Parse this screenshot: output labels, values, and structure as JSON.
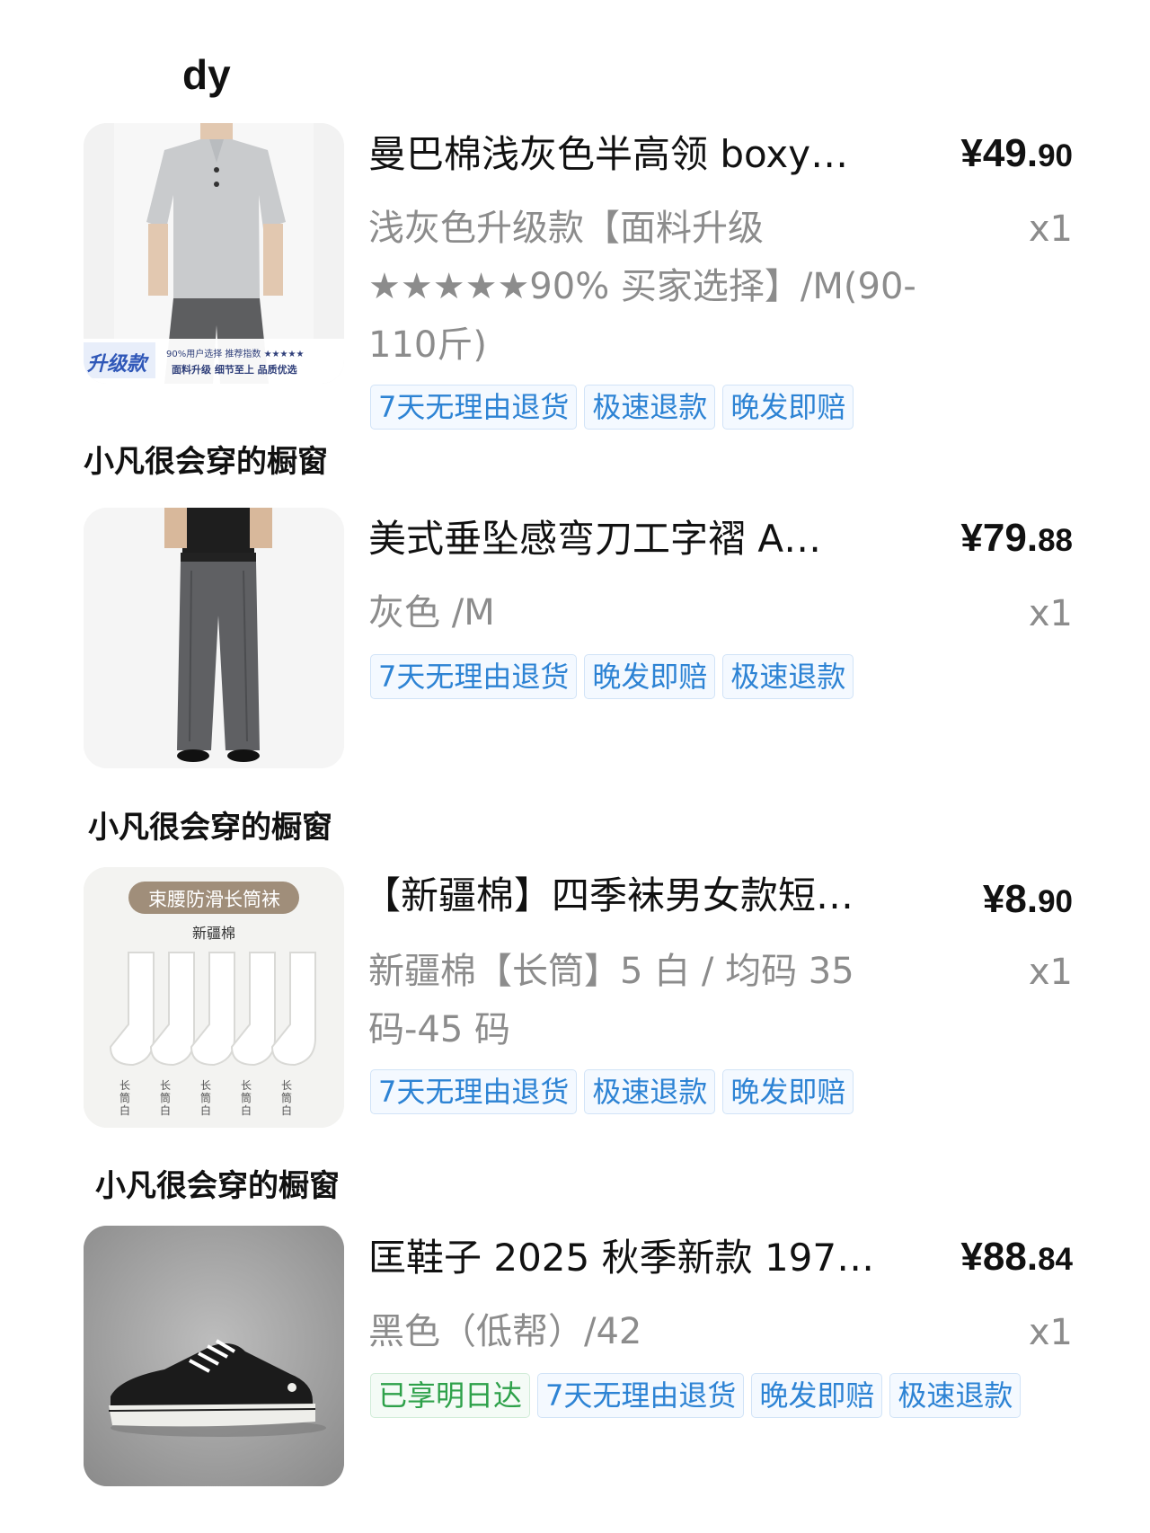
{
  "top_label": "dy",
  "shop_label": "小凡很会穿的橱窗",
  "items": [
    {
      "title": "曼巴棉浅灰色半高领 boxy…",
      "price_big": "¥49.",
      "price_small": "90",
      "variant": "浅灰色升级款【面料升级★★★★★90% 买家选择】/M(90-110斤)",
      "qty": "x1",
      "image_badge": "升级款",
      "image_caption_1": "90%用户选择  推荐指数 ★★★★★",
      "image_caption_2": "面料升级 细节至上 品质优选",
      "tags": [
        "7天无理由退货",
        "极速退款",
        "晚发即赔"
      ]
    },
    {
      "title": "美式垂坠感弯刀工字褶 A…",
      "price_big": "¥79.",
      "price_small": "88",
      "variant": "灰色 /M",
      "qty": "x1",
      "tags": [
        "7天无理由退货",
        "晚发即赔",
        "极速退款"
      ]
    },
    {
      "title": "【新疆棉】四季袜男女款短…",
      "price_big": "¥8.",
      "price_small": "90",
      "variant": "新疆棉【长筒】5 白 / 均码 35 码-45 码",
      "qty": "x1",
      "image_banner": "束腰防滑长筒袜",
      "image_sub": "新疆棉",
      "image_sock_label": "长筒白",
      "tags": [
        "7天无理由退货",
        "极速退款",
        "晚发即赔"
      ]
    },
    {
      "title": "匡鞋子 2025 秋季新款 197…",
      "price_big": "¥88.",
      "price_small": "84",
      "variant": "黑色（低帮）/42",
      "qty": "x1",
      "tags": [
        "已享明日达",
        "7天无理由退货",
        "晚发即赔",
        "极速退款"
      ]
    }
  ],
  "colors": {
    "tag_blue": "#2d83d4",
    "tag_green": "#2ea14a",
    "secondary_text": "#8c8c8c"
  }
}
